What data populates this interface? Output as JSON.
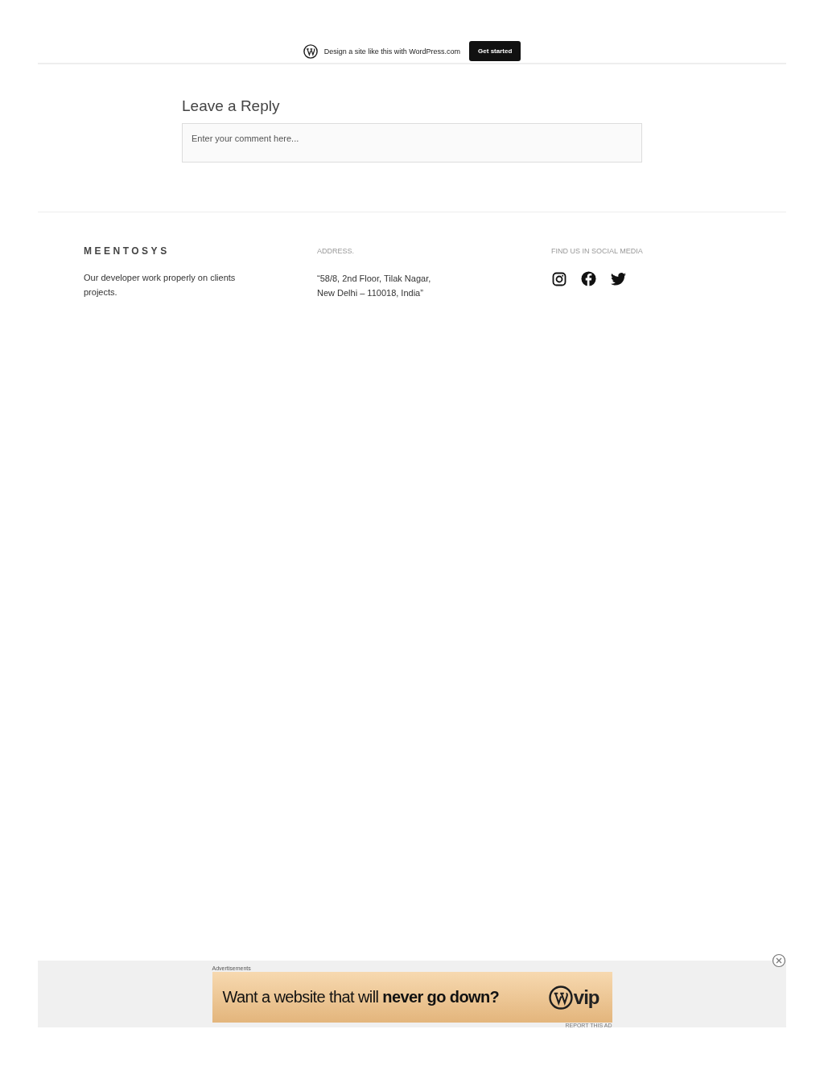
{
  "top_banner": {
    "text": "Design a site like this with WordPress.com",
    "button": "Get started"
  },
  "reply": {
    "title": "Leave a Reply",
    "placeholder": "Enter your comment here..."
  },
  "footer": {
    "brand": "MEENTOSYS",
    "tagline": "Our developer work properly on clients projects.",
    "address_heading": "ADDRESS.",
    "address_lines": [
      "“58/8, 2nd Floor, Tilak Nagar,",
      "New Delhi – 110018, India”"
    ],
    "social_heading": "FIND US IN SOCIAL MEDIA",
    "social": [
      {
        "kind": "instagram"
      },
      {
        "kind": "facebook"
      },
      {
        "kind": "twitter"
      }
    ]
  },
  "ad": {
    "label": "Advertisements",
    "headline": "Want a website that will **never go down?**",
    "logo_text": "vip",
    "report": "REPORT THIS AD"
  }
}
